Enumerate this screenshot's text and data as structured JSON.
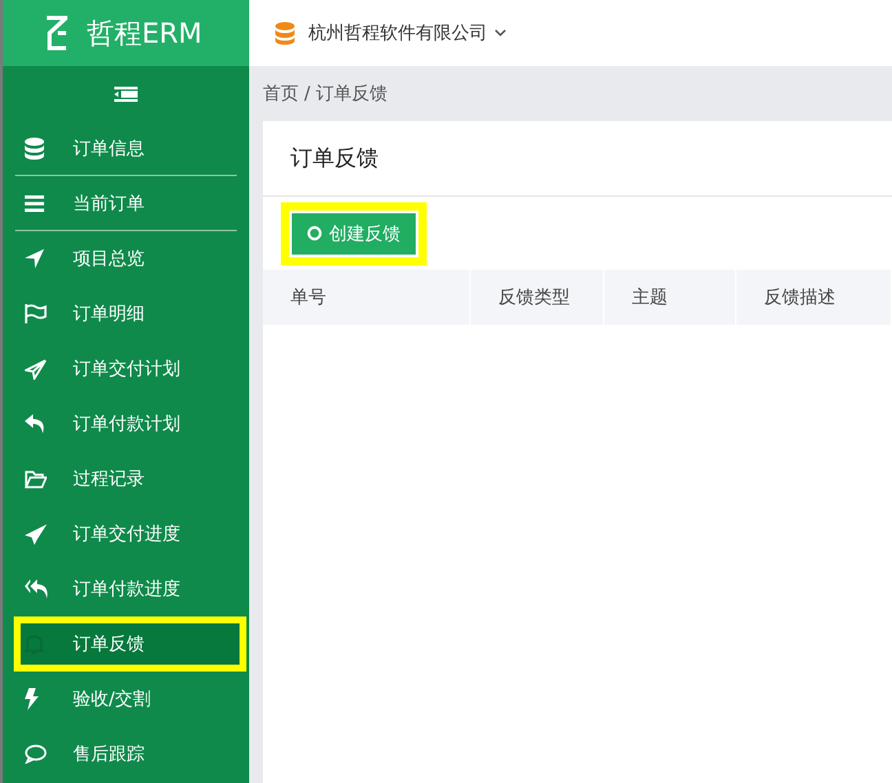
{
  "app": {
    "logo_text": "哲程ERM"
  },
  "header": {
    "company": "杭州哲程软件有限公司"
  },
  "breadcrumb": {
    "home": "首页",
    "separator": "/",
    "current": "订单反馈"
  },
  "sidebar": {
    "items": [
      {
        "label": "订单信息",
        "selected": false,
        "highlighted": false,
        "divider": true
      },
      {
        "label": "当前订单",
        "selected": false,
        "highlighted": false,
        "divider": true
      },
      {
        "label": "项目总览",
        "selected": false,
        "highlighted": false,
        "divider": false
      },
      {
        "label": "订单明细",
        "selected": false,
        "highlighted": false,
        "divider": false
      },
      {
        "label": "订单交付计划",
        "selected": false,
        "highlighted": false,
        "divider": false
      },
      {
        "label": "订单付款计划",
        "selected": false,
        "highlighted": false,
        "divider": false
      },
      {
        "label": "过程记录",
        "selected": false,
        "highlighted": false,
        "divider": false
      },
      {
        "label": "订单交付进度",
        "selected": false,
        "highlighted": false,
        "divider": false
      },
      {
        "label": "订单付款进度",
        "selected": false,
        "highlighted": false,
        "divider": false
      },
      {
        "label": "订单反馈",
        "selected": true,
        "highlighted": true,
        "divider": false
      },
      {
        "label": "验收/交割",
        "selected": false,
        "highlighted": false,
        "divider": false
      },
      {
        "label": "售后跟踪",
        "selected": false,
        "highlighted": false,
        "divider": false
      }
    ]
  },
  "card": {
    "title": "订单反馈",
    "create_button": {
      "label": "创建反馈",
      "highlighted": true
    },
    "table": {
      "columns": [
        "单号",
        "反馈类型",
        "主题",
        "反馈描述"
      ]
    }
  }
}
